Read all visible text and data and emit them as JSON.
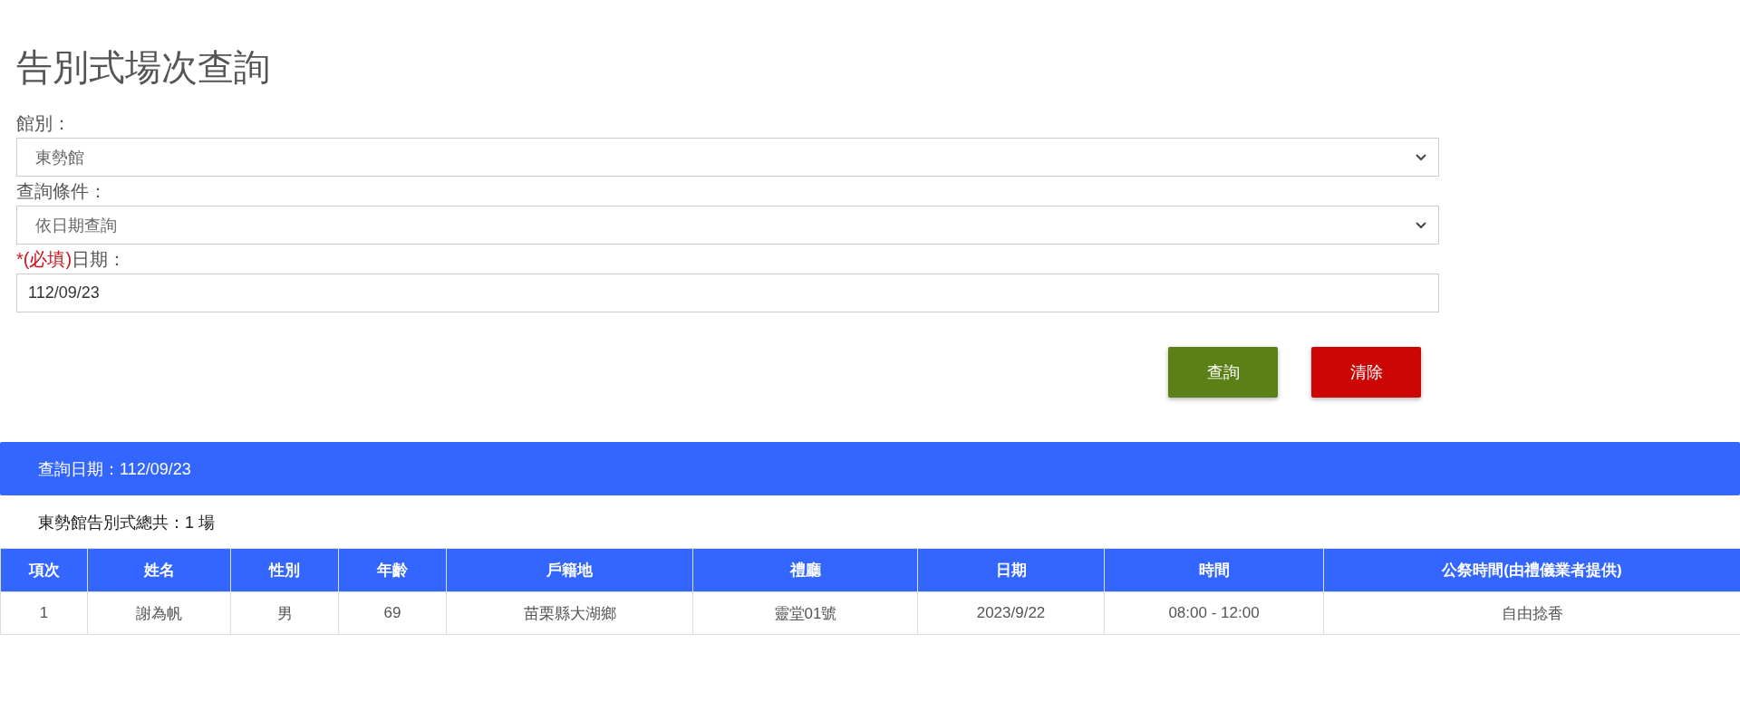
{
  "title": "告別式場次查詢",
  "form": {
    "fields": [
      {
        "kind": "select",
        "label": "館別：",
        "value": "東勢館"
      },
      {
        "kind": "select",
        "label": "查詢條件：",
        "value": "依日期查詢"
      },
      {
        "kind": "input",
        "required_mark": "*(必填)",
        "label": "日期：",
        "value": "112/09/23"
      }
    ]
  },
  "buttons": [
    {
      "label": "查詢",
      "kind": "primary"
    },
    {
      "label": "清除",
      "kind": "danger"
    }
  ],
  "result_bar": {
    "text": "查詢日期：112/09/23"
  },
  "summary": "東勢館告別式總共：1 場",
  "table": {
    "columns": [
      "項次",
      "姓名",
      "性別",
      "年齡",
      "戶籍地",
      "禮廳",
      "日期",
      "時間",
      "公祭時間(由禮儀業者提供)"
    ],
    "rows": [
      [
        "1",
        "謝為帆",
        "男",
        "69",
        "苗栗縣大湖鄉",
        "靈堂01號",
        "2023/9/22",
        "08:00 - 12:00",
        "自由捻香"
      ]
    ]
  }
}
